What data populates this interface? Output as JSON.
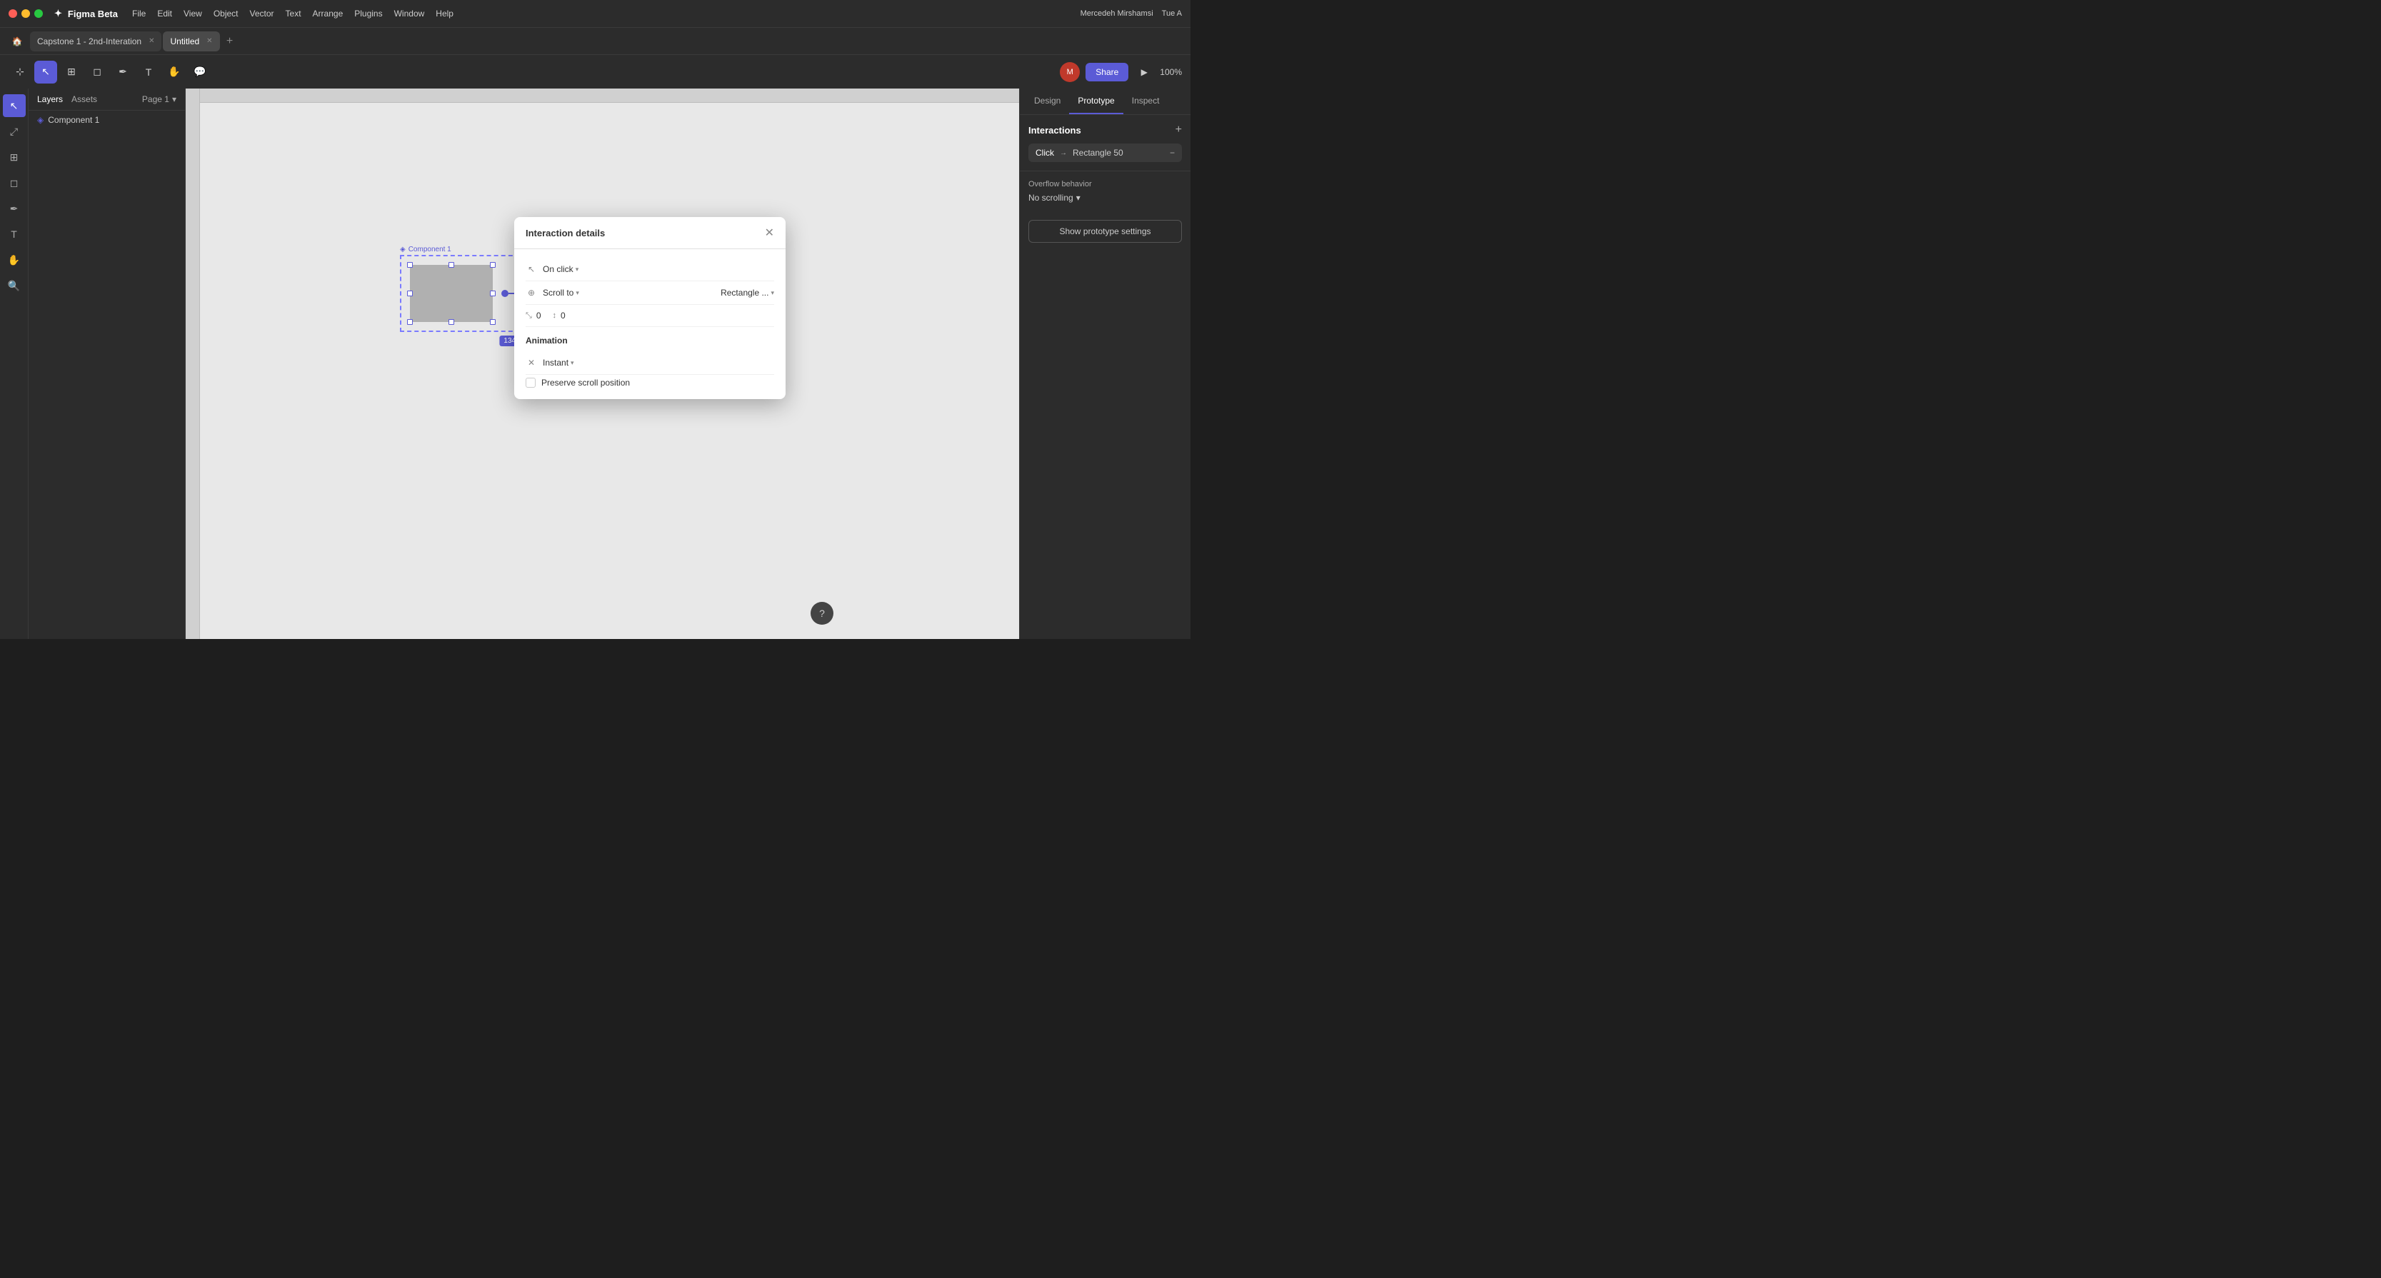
{
  "app": {
    "name": "Figma Beta",
    "logo": "✦"
  },
  "titlebar": {
    "menu_items": [
      "File",
      "Edit",
      "View",
      "Object",
      "Vector",
      "Text",
      "Arrange",
      "Plugins",
      "Window",
      "Help"
    ],
    "user": "Mercedeh Mirshamsi",
    "time": "Tue A"
  },
  "tabs": [
    {
      "label": "Capstone 1 - 2nd-Interation",
      "active": false
    },
    {
      "label": "Untitled",
      "active": true
    }
  ],
  "toolbar": {
    "share_label": "Share",
    "zoom_label": "100%"
  },
  "layers": {
    "tabs": [
      "Layers",
      "Assets"
    ],
    "active_tab": "Layers",
    "page": "Page 1",
    "items": [
      {
        "label": "Component 1",
        "type": "component"
      }
    ]
  },
  "canvas": {
    "component_label": "Component 1",
    "size_label": "134 × 80"
  },
  "right_panel": {
    "tabs": [
      "Design",
      "Prototype",
      "Inspect"
    ],
    "active_tab": "Prototype",
    "interactions_title": "Interactions",
    "interaction": {
      "trigger": "Click",
      "target": "Rectangle 50"
    },
    "overflow_title": "Overflow behavior",
    "overflow_value": "No scrolling",
    "proto_settings_label": "Show prototype settings"
  },
  "modal": {
    "title": "Interaction details",
    "trigger_label": "On click",
    "action_label": "Scroll to",
    "target_label": "Rectangle ...",
    "x_val": "0",
    "y_val": "0",
    "animation_title": "Animation",
    "animation_type": "Instant",
    "preserve_scroll_label": "Preserve scroll position"
  },
  "icons": {
    "close": "✕",
    "chevron_down": "▾",
    "plus": "+",
    "minus": "−",
    "play": "▶",
    "help": "?",
    "component": "◈",
    "cursor": "↖",
    "frame": "⊞",
    "shape": "◻",
    "pen": "✒",
    "text": "T",
    "hand": "✋",
    "comment": "💬",
    "move": "⊹",
    "scale": "⤢",
    "lock": "⊕",
    "animation_x": "⤡"
  }
}
